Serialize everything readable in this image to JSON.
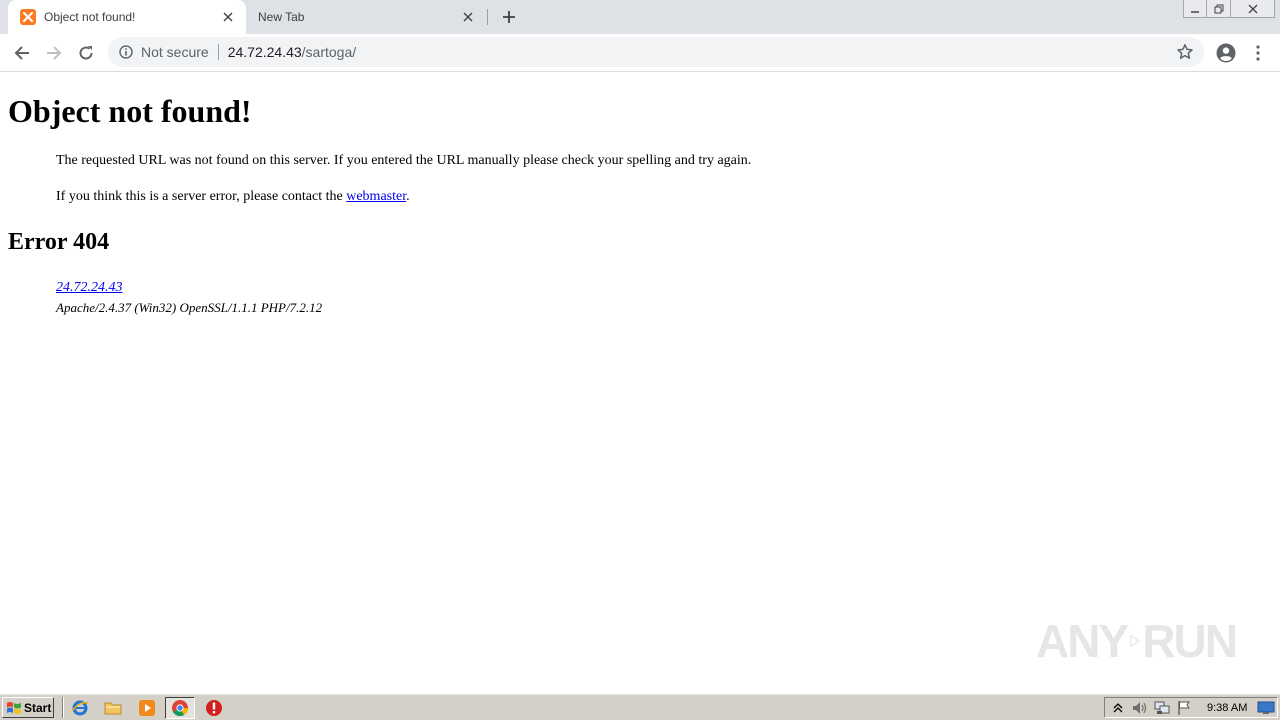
{
  "browser": {
    "tabs": [
      {
        "title": "Object not found!",
        "active": true
      },
      {
        "title": "New Tab",
        "active": false
      }
    ],
    "toolbar": {
      "security_label": "Not secure",
      "url_host": "24.72.24.43",
      "url_path": "/sartoga/"
    }
  },
  "page": {
    "heading": "Object not found!",
    "message_1": "The requested URL was not found on this server. If you entered the URL manually please check your spelling and try again.",
    "message_2_before": "If you think this is a server error, please contact the ",
    "message_2_link": "webmaster",
    "message_2_after": ".",
    "error_heading": "Error 404",
    "address_link": "24.72.24.43",
    "server_signature": "Apache/2.4.37 (Win32) OpenSSL/1.1.1 PHP/7.2.12"
  },
  "watermark": {
    "left": "ANY",
    "right": "RUN"
  },
  "taskbar": {
    "start_label": "Start",
    "quick_launch": [
      "ie-icon",
      "folder-icon",
      "media-player-icon",
      "chrome-icon",
      "stop-icon"
    ],
    "tray_icons": [
      "chevron-up-icon",
      "volume-icon",
      "network-icon",
      "flag-icon"
    ],
    "clock": "9:38 AM"
  },
  "colors": {
    "tab_strip": "#dee1e6",
    "link": "#0000ee",
    "taskbar": "#d4d0c8",
    "favicon": "#fb7a24"
  }
}
